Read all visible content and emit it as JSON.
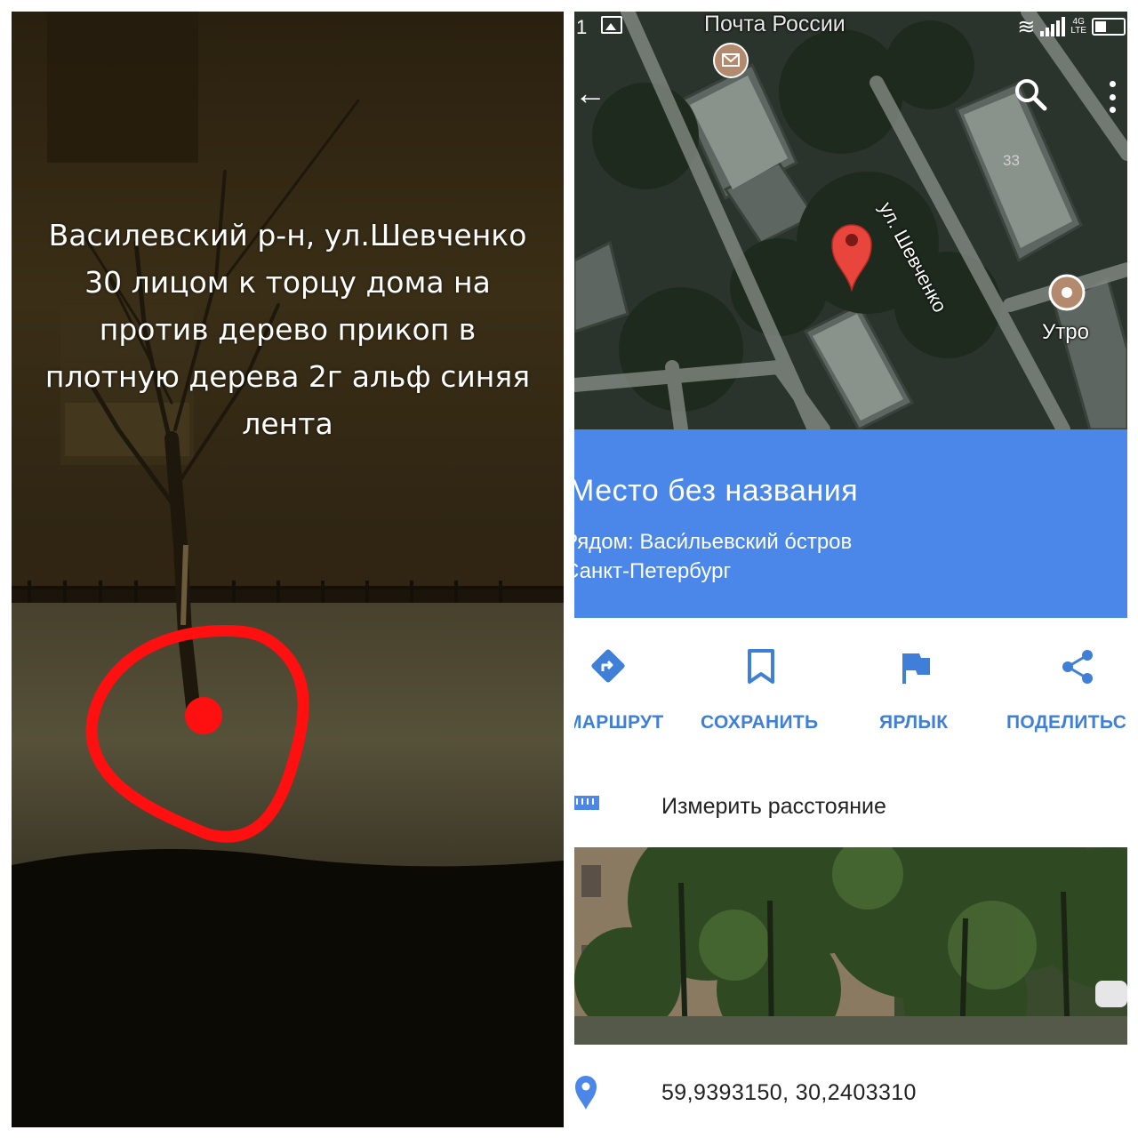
{
  "left_panel": {
    "caption_lines": [
      "Василевский р-н, ул.Шевченко",
      "30 лицом к торцу дома на",
      "против дерево прикоп в",
      "плотную дерева 2г альф синяя",
      "лента"
    ],
    "marker_color": "#ff1010"
  },
  "phone": {
    "status_bar": {
      "time": "1",
      "network": "4G",
      "lte": "LTE"
    },
    "map": {
      "top_poi": "Почта России",
      "street": "ул. Шевченко",
      "house_number": "33",
      "poi": "Утро",
      "pin_color": "#e8453c"
    },
    "place": {
      "title": "Место без названия",
      "nearby": "Рядом: Васи́льевский о́стров",
      "city": "Санкт-Петербург",
      "background": "#4a87e8"
    },
    "actions": [
      {
        "label": "МАРШРУТ",
        "icon": "directions-icon"
      },
      {
        "label": "СОХРАНИТЬ",
        "icon": "bookmark-icon"
      },
      {
        "label": "ЯРЛЫК",
        "icon": "flag-icon"
      },
      {
        "label": "ПОДЕЛИТЬСЯ",
        "icon": "share-icon"
      }
    ],
    "measure_label": "Измерить расстояние",
    "coordinates": "59,9393150, 30,2403310",
    "accent": "#3f7fd8"
  }
}
